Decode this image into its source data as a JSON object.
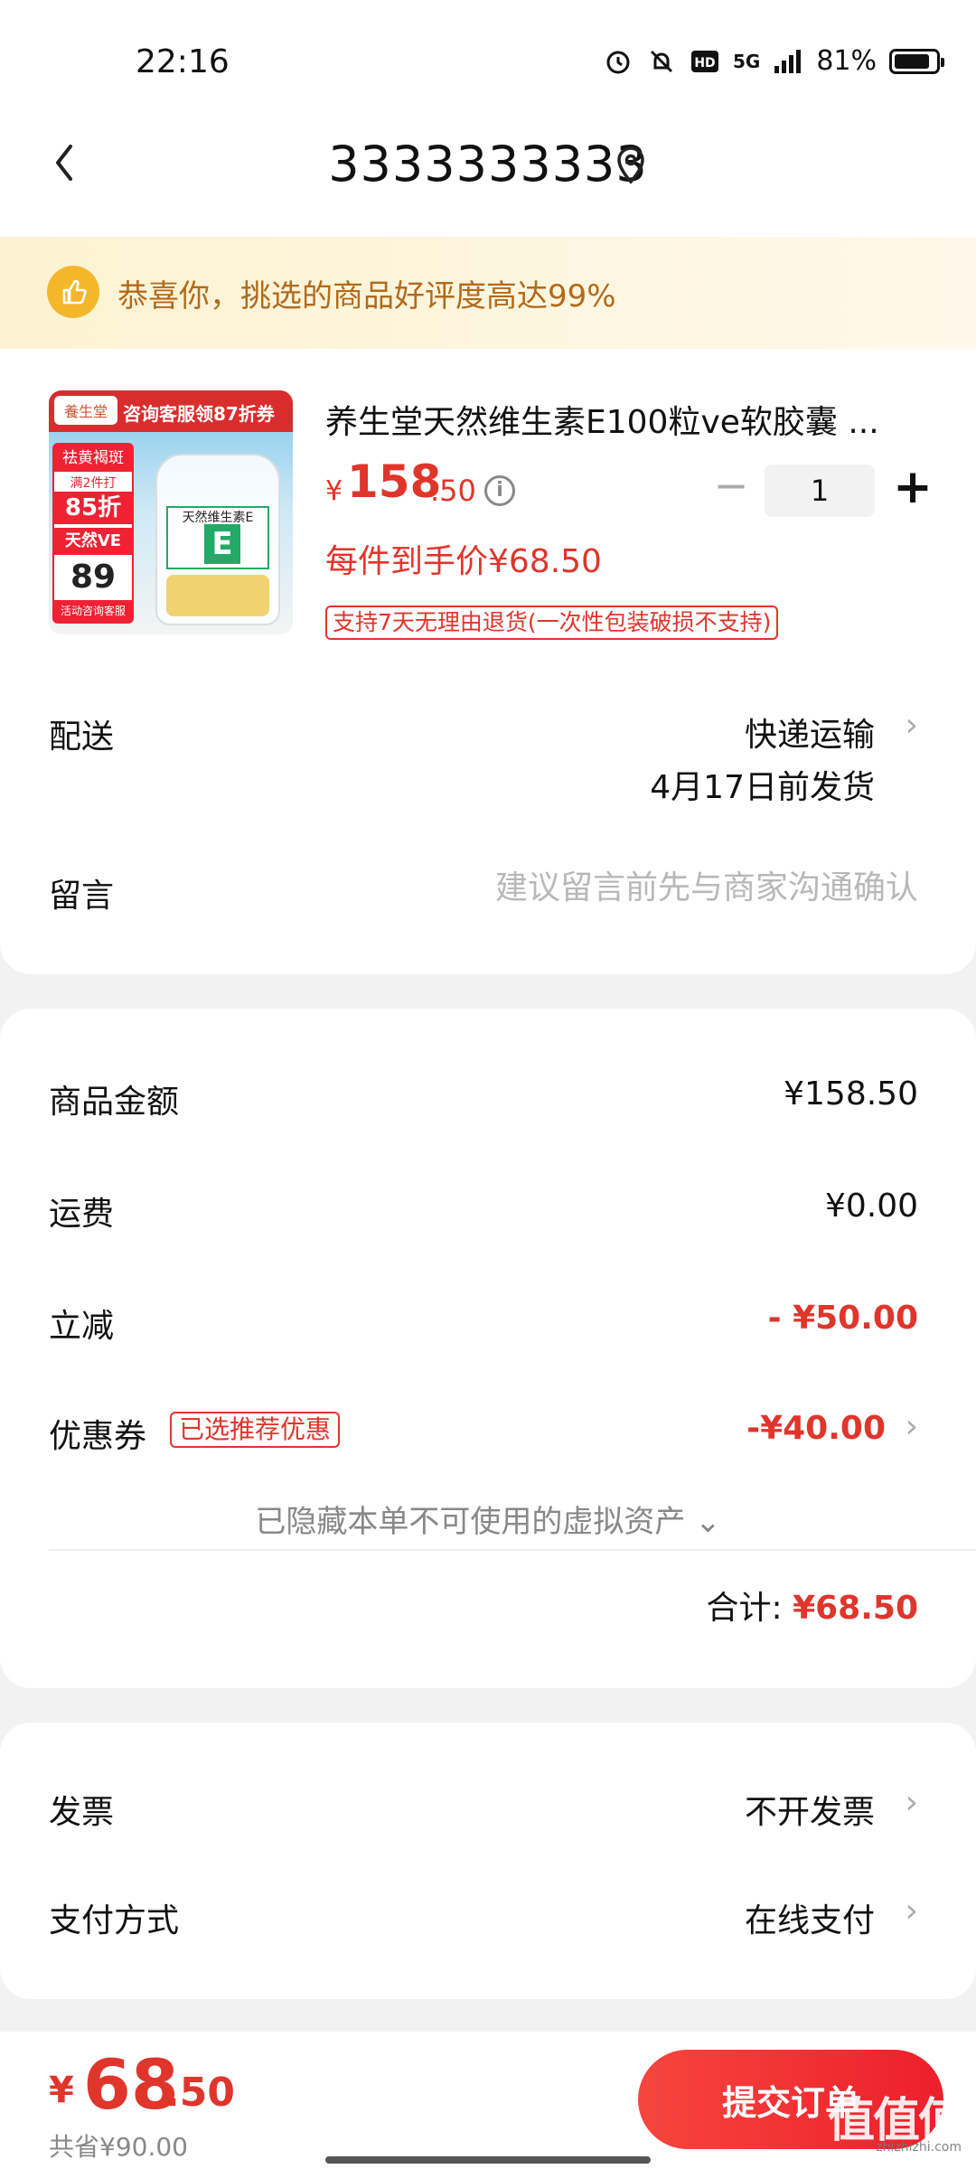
{
  "status_bar": {
    "time": "22:16",
    "network": "5G",
    "battery": "81%",
    "icons": [
      "alarm-icon",
      "bell-off-icon",
      "hd-icon",
      "signal-icon",
      "battery-icon"
    ]
  },
  "header": {
    "title": "3333333333",
    "back_icon": "chevron-left-icon",
    "location_icon": "location-pin-icon"
  },
  "banner": {
    "icon": "thumbs-up-icon",
    "text": "恭喜你，挑选的商品好评度高达99%"
  },
  "product": {
    "title": "养生堂天然维生素E100粒ve软胶囊 ...",
    "currency": "¥",
    "price_int": "158",
    "price_dec": ".50",
    "quantity": "1",
    "minus_label": "−",
    "plus_label": "+",
    "unit_price": "每件到手价¥68.50",
    "return_policy": "支持7天无理由退货(一次性包装破损不支持)",
    "image": {
      "logo": "養生堂",
      "top_text": "咨询客服领87折券",
      "tag1": "祛黄褐斑",
      "tag2": "满2件打",
      "tag3": "85折",
      "tag4": "天然VE",
      "tag5": "89",
      "tag6": "活动咨询客服",
      "bottle_label": "天然维生素E",
      "bottle_letter": "E"
    }
  },
  "shipping": {
    "label": "配送",
    "method": "快递运输",
    "date": "4月17日前发货"
  },
  "message": {
    "label": "留言",
    "placeholder": "建议留言前先与商家沟通确认",
    "value": ""
  },
  "amounts": {
    "goods_label": "商品金额",
    "goods_value": "¥158.50",
    "freight_label": "运费",
    "freight_value": "¥0.00",
    "discount_label": "立减",
    "discount_value": "- ¥50.00",
    "coupon_label": "优惠券",
    "coupon_tag": "已选推荐优惠",
    "coupon_value": "-¥40.00",
    "hidden_note": "已隐藏本单不可使用的虚拟资产",
    "total_label": "合计:",
    "total_value": "¥68.50"
  },
  "invoice": {
    "label": "发票",
    "value": "不开发票"
  },
  "payment": {
    "label": "支付方式",
    "value": "在线支付"
  },
  "bottom": {
    "currency": "¥",
    "total_int": "68",
    "total_dec": ".50",
    "saved": "共省¥90.00",
    "submit_label": "提交订单",
    "watermark": "值值值",
    "watermark_sub": "zhizhizhi.com"
  },
  "colors": {
    "accent": "#e0352b",
    "banner_text": "#b36a1b",
    "banner_bg": "#fdf3d2"
  }
}
